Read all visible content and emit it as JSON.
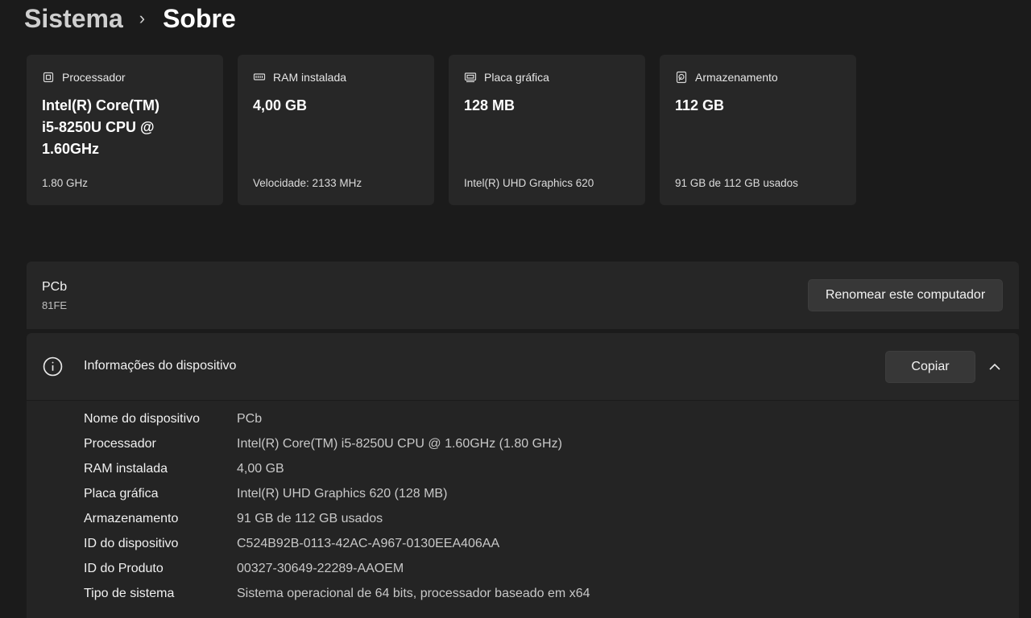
{
  "breadcrumb": {
    "parent": "Sistema",
    "separator": "›",
    "current": "Sobre"
  },
  "cards": [
    {
      "icon": "processor-icon",
      "title": "Processador",
      "value": "Intel(R) Core(TM) i5-8250U CPU @ 1.60GHz",
      "value_lines": [
        "Intel(R) Core(TM)",
        "i5-8250U CPU @",
        "1.60GHz"
      ],
      "sub": "1.80 GHz"
    },
    {
      "icon": "ram-icon",
      "title": "RAM instalada",
      "value": "4,00 GB",
      "sub": "Velocidade: 2133 MHz"
    },
    {
      "icon": "graphics-card-icon",
      "title": "Placa gráfica",
      "value": "128 MB",
      "sub": "Intel(R) UHD Graphics 620"
    },
    {
      "icon": "storage-icon",
      "title": "Armazenamento",
      "value": "112 GB",
      "sub": "91 GB de 112 GB usados"
    }
  ],
  "pc": {
    "name": "PCb",
    "model": "81FE",
    "rename_label": "Renomear este computador"
  },
  "device_info": {
    "title": "Informações do dispositivo",
    "copy_label": "Copiar",
    "rows": [
      {
        "key": "Nome do dispositivo",
        "value": "PCb"
      },
      {
        "key": "Processador",
        "value": "Intel(R) Core(TM) i5-8250U CPU @ 1.60GHz (1.80 GHz)"
      },
      {
        "key": "RAM instalada",
        "value": "4,00 GB"
      },
      {
        "key": "Placa gráfica",
        "value": "Intel(R) UHD Graphics 620 (128 MB)"
      },
      {
        "key": "Armazenamento",
        "value": "91 GB de 112 GB usados"
      },
      {
        "key": "ID do dispositivo",
        "value": "C524B92B-0113-42AC-A967-0130EEA406AA"
      },
      {
        "key": "ID do Produto",
        "value": "00327-30649-22289-AAOEM"
      },
      {
        "key": "Tipo de sistema",
        "value": "Sistema operacional de 64 bits, processador baseado em x64"
      }
    ]
  }
}
